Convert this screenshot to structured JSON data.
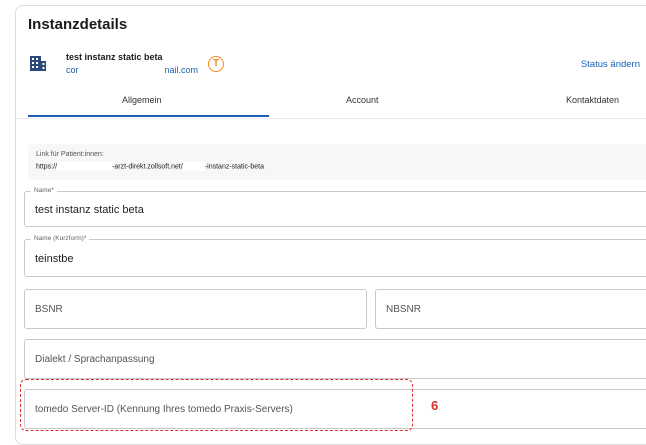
{
  "header": {
    "title": "Instanzdetails",
    "instance_name": "test instanz static beta",
    "email_prefix": "cor",
    "email_suffix": "nail.com",
    "t_icon_glyph": "T",
    "status_link": "Status ändern"
  },
  "tabs": [
    {
      "label": "Allgemein",
      "active": true
    },
    {
      "label": "Account",
      "active": false
    },
    {
      "label": "Kontaktdaten",
      "active": false
    }
  ],
  "patient_link": {
    "label": "Link für Patient:innen:",
    "url_part1": "https://",
    "url_part2": "-arzt-direkt.zollsoft.net/",
    "url_part3": "-instanz-static-beta"
  },
  "form": {
    "name": {
      "label": "Name*",
      "value": "test instanz static beta"
    },
    "short_name": {
      "label": "Name (Kurzform)*",
      "value": "teinstbe"
    },
    "bsnr": {
      "placeholder": "BSNR"
    },
    "nbsnr": {
      "placeholder": "NBSNR"
    },
    "dialect": {
      "placeholder": "Dialekt / Sprachanpassung"
    },
    "server_id": {
      "placeholder": "tomedo Server-ID (Kennung Ihres tomedo Praxis-Servers)"
    }
  },
  "annotation": {
    "number": "6",
    "color": "#d9302c"
  },
  "colors": {
    "accent": "#1a5fb4",
    "warning_icon": "#f08a1c"
  },
  "icons": {
    "building": "building-icon",
    "tomedo": "tomedo-t-icon"
  }
}
